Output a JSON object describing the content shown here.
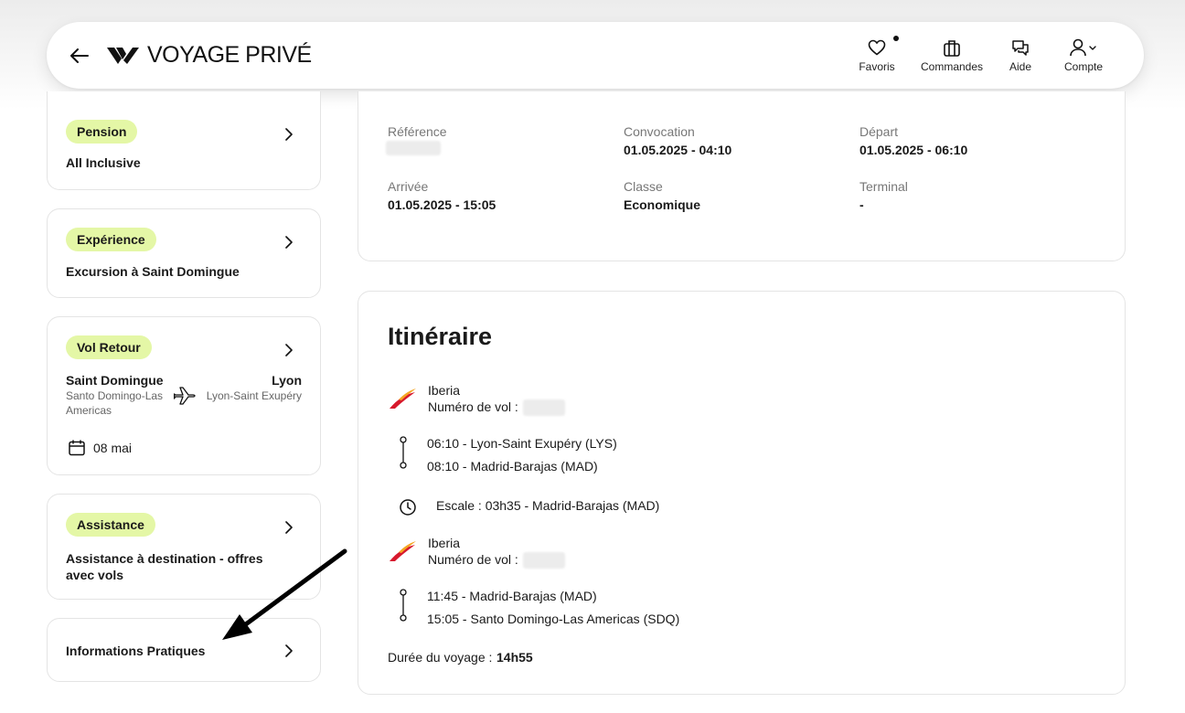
{
  "header": {
    "brand": "VOYAGE PRIVÉ",
    "nav": [
      {
        "label": "Favoris",
        "icon": "heart-icon"
      },
      {
        "label": "Commandes",
        "icon": "suitcase-icon"
      },
      {
        "label": "Aide",
        "icon": "chat-icon"
      },
      {
        "label": "Compte",
        "icon": "user-icon"
      }
    ]
  },
  "sidebar": {
    "pension": {
      "badge": "Pension",
      "value": "All Inclusive"
    },
    "experience": {
      "badge": "Expérience",
      "value": "Excursion à Saint Domingue"
    },
    "vol_retour": {
      "badge": "Vol Retour",
      "from_city": "Saint Domingue",
      "from_airport": "Santo Domingo-Las Americas",
      "to_city": "Lyon",
      "to_airport": "Lyon-Saint Exupéry",
      "date": "08 mai"
    },
    "assistance": {
      "badge": "Assistance",
      "value": "Assistance à destination - offres avec vols"
    },
    "infos": {
      "label": "Informations Pratiques"
    }
  },
  "flight_info": {
    "reference_label": "Référence",
    "convocation_label": "Convocation",
    "convocation_value": "01.05.2025 - 04:10",
    "depart_label": "Départ",
    "depart_value": "01.05.2025 - 06:10",
    "arrivee_label": "Arrivée",
    "arrivee_value": "01.05.2025 - 15:05",
    "classe_label": "Classe",
    "classe_value": "Economique",
    "terminal_label": "Terminal",
    "terminal_value": "-"
  },
  "itinerary": {
    "title": "Itinéraire",
    "segments": [
      {
        "airline": "Iberia",
        "flight_label": "Numéro de vol :",
        "departure": "06:10 - Lyon-Saint Exupéry (LYS)",
        "arrival": "08:10 - Madrid-Barajas (MAD)"
      },
      {
        "airline": "Iberia",
        "flight_label": "Numéro de vol :",
        "departure": "11:45 - Madrid-Barajas (MAD)",
        "arrival": "15:05 - Santo Domingo-Las Americas (SDQ)"
      }
    ],
    "stopover": "Escale : 03h35 - Madrid-Barajas (MAD)",
    "duration_label": "Durée du voyage :",
    "duration_value": "14h55"
  },
  "colors": {
    "badge_bg": "#e4f7a6",
    "iberia_red": "#d7192d",
    "iberia_yellow": "#f5a623"
  }
}
